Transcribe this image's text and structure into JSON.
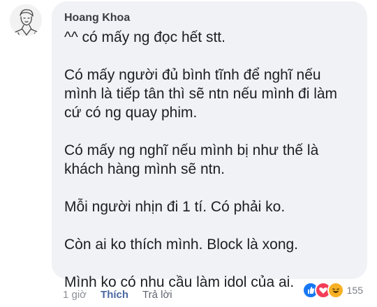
{
  "comment": {
    "author": "Hoang Khoa",
    "paragraphs": [
      "^^ có mấy ng đọc hết stt.",
      "Có mấy người đủ bình tĩnh để nghĩ nếu mình là tiếp tân thì sẽ ntn nếu mình đi làm cứ có ng quay phim.",
      "Có mấy ng nghĩ nếu mình bị như thế là khách hàng mình sẽ ntn.",
      "Mỗi người nhịn đi 1 tí. Có phải ko.",
      "Còn ai ko thích mình. Block là xong.",
      "Mình ko có nhu cầu làm idol của ai."
    ]
  },
  "actions": {
    "time": "1 giờ",
    "like_label": "Thích",
    "reply_label": "Trả lời"
  },
  "reactions": {
    "icons": [
      "like-reaction-icon",
      "love-reaction-icon",
      "haha-reaction-icon"
    ],
    "count": "155",
    "colors": {
      "like": "#1877f2",
      "love": "#f33e58",
      "haha": "#f7b125"
    }
  }
}
